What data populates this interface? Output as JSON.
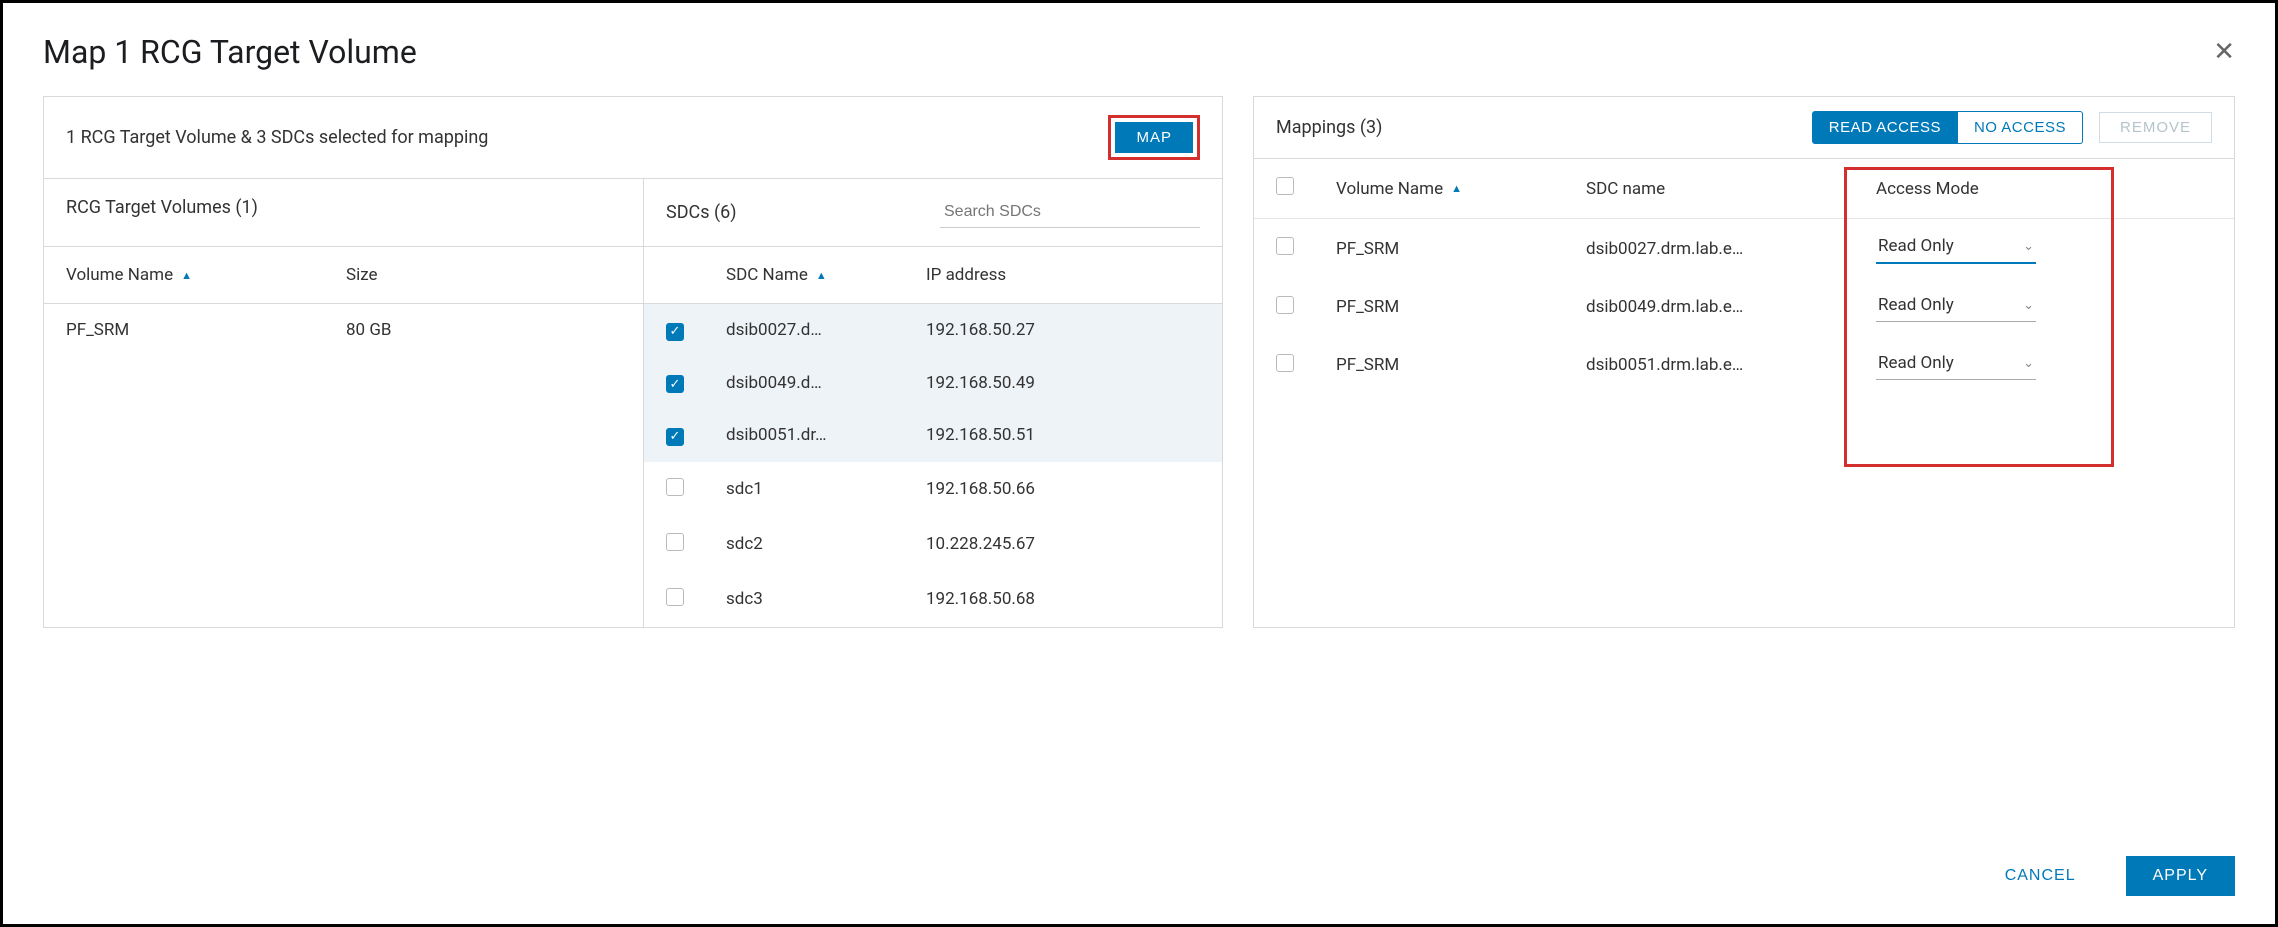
{
  "modal": {
    "title": "Map 1 RCG Target Volume"
  },
  "left": {
    "summary": "1 RCG Target Volume & 3 SDCs selected for mapping",
    "map_label": "MAP",
    "volumes_header": "RCG Target Volumes (1)",
    "sdcs_header": "SDCs (6)",
    "search_placeholder": "Search SDCs",
    "th_volume": "Volume Name",
    "th_size": "Size",
    "th_sdcname": "SDC Name",
    "th_ip": "IP address",
    "volumes": [
      {
        "name": "PF_SRM",
        "size": "80 GB"
      }
    ],
    "sdcs": [
      {
        "name": "dsib0027.d…",
        "ip": "192.168.50.27",
        "checked": true
      },
      {
        "name": "dsib0049.d…",
        "ip": "192.168.50.49",
        "checked": true
      },
      {
        "name": "dsib0051.dr…",
        "ip": "192.168.50.51",
        "checked": true
      },
      {
        "name": "sdc1",
        "ip": "192.168.50.66",
        "checked": false
      },
      {
        "name": "sdc2",
        "ip": "10.228.245.67",
        "checked": false
      },
      {
        "name": "sdc3",
        "ip": "192.168.50.68",
        "checked": false
      }
    ]
  },
  "right": {
    "title": "Mappings (3)",
    "read_access": "READ ACCESS",
    "no_access": "NO ACCESS",
    "remove": "REMOVE",
    "th_volume": "Volume Name",
    "th_sdc": "SDC name",
    "th_am": "Access Mode",
    "rows": [
      {
        "volume": "PF_SRM",
        "sdc": "dsib0027.drm.lab.e…",
        "mode": "Read Only"
      },
      {
        "volume": "PF_SRM",
        "sdc": "dsib0049.drm.lab.e…",
        "mode": "Read Only"
      },
      {
        "volume": "PF_SRM",
        "sdc": "dsib0051.drm.lab.e…",
        "mode": "Read Only"
      }
    ]
  },
  "footer": {
    "cancel": "CANCEL",
    "apply": "APPLY"
  }
}
